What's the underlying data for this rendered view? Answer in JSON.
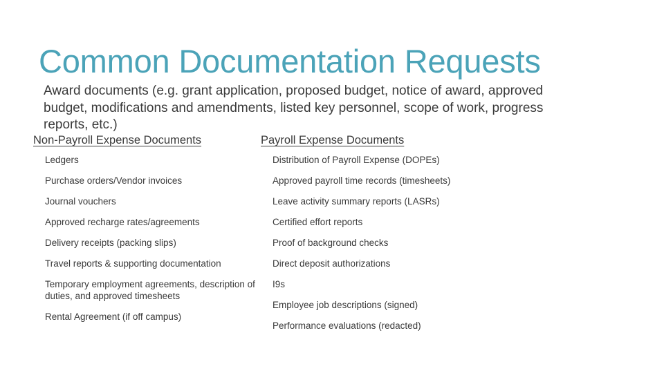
{
  "slide": {
    "title": "Common Documentation Requests",
    "subtitle": "Award documents (e.g. grant application, proposed budget, notice of award, approved budget, modifications and amendments, listed key personnel, scope of work, progress reports, etc.)",
    "colors": {
      "title": "#4BA3B8",
      "body_text": "#3A3A3A",
      "background": "#FFFFFF"
    }
  },
  "columns": [
    {
      "header": "Non-Payroll Expense Documents",
      "items": [
        "Ledgers",
        "Purchase orders/Vendor invoices",
        "Journal vouchers",
        "Approved recharge rates/agreements",
        "Delivery receipts (packing slips)",
        "Travel reports & supporting documentation",
        "Temporary employment agreements, description of duties, and approved timesheets",
        "Rental Agreement (if off campus)"
      ]
    },
    {
      "header": "Payroll Expense Documents",
      "items": [
        "Distribution of Payroll Expense (DOPEs)",
        "Approved payroll time records (timesheets)",
        "Leave activity summary reports (LASRs)",
        "Certified effort reports",
        "Proof of background checks",
        "Direct deposit authorizations",
        "I9s",
        "Employee job descriptions (signed)",
        "Performance evaluations (redacted)"
      ]
    }
  ]
}
